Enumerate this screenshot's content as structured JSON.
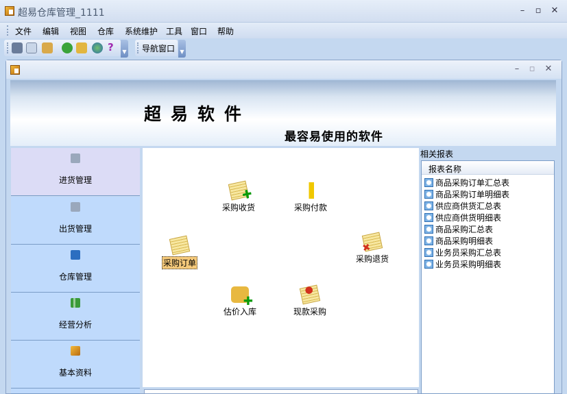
{
  "app": {
    "title": "超易仓库管理_1111"
  },
  "menu": [
    "文件",
    "编辑",
    "视图",
    "仓库",
    "系统维护",
    "工具",
    "窗口",
    "帮助"
  ],
  "toolbar": {
    "icons": [
      "cut-icon",
      "copy-icon",
      "paste-icon",
      "refresh-icon",
      "edit-icon",
      "globe-icon",
      "help-icon"
    ],
    "nav_window": "导航窗口"
  },
  "banner": {
    "title": "超易软件",
    "subtitle": "最容易使用的软件"
  },
  "nav": [
    {
      "label": "进货管理",
      "selected": true
    },
    {
      "label": "出货管理"
    },
    {
      "label": "仓库管理"
    },
    {
      "label": "经营分析"
    },
    {
      "label": "基本资料"
    }
  ],
  "actions": {
    "order": "采购订单",
    "receive": "采购收货",
    "pay": "采购付款",
    "return": "采购退货",
    "estimate": "估价入库",
    "cash": "现款采购"
  },
  "reports": {
    "label": "相关报表",
    "column": "报表名称",
    "items": [
      "商品采购订单汇总表",
      "商品采购订单明细表",
      "供应商供货汇总表",
      "供应商供货明细表",
      "商品采购汇总表",
      "商品采购明细表",
      "业务员采购汇总表",
      "业务员采购明细表"
    ]
  }
}
